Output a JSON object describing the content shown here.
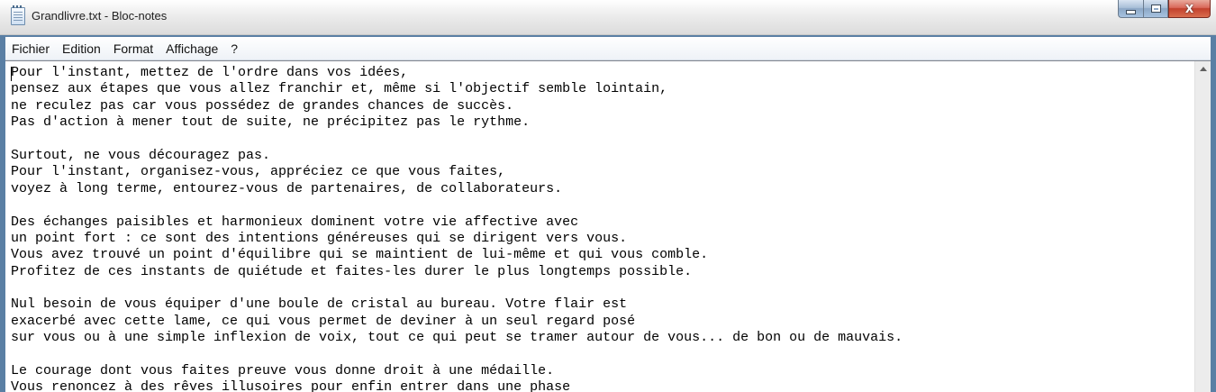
{
  "window": {
    "title": "Grandlivre.txt - Bloc-notes",
    "controls": {
      "minimize_icon": "minimize-icon",
      "maximize_icon": "maximize-icon",
      "close_label": "X"
    }
  },
  "menu": {
    "items": [
      {
        "label": "Fichier"
      },
      {
        "label": "Edition"
      },
      {
        "label": "Format"
      },
      {
        "label": "Affichage"
      },
      {
        "label": "?"
      }
    ]
  },
  "editor": {
    "lines": [
      "Pour l'instant, mettez de l'ordre dans vos idées,",
      "pensez aux étapes que vous allez franchir et, même si l'objectif semble lointain,",
      "ne reculez pas car vous possédez de grandes chances de succès.",
      "Pas d'action à mener tout de suite, ne précipitez pas le rythme.",
      "",
      "Surtout, ne vous découragez pas.",
      "Pour l'instant, organisez-vous, appréciez ce que vous faites,",
      "voyez à long terme, entourez-vous de partenaires, de collaborateurs.",
      "",
      "Des échanges paisibles et harmonieux dominent votre vie affective avec",
      "un point fort : ce sont des intentions généreuses qui se dirigent vers vous.",
      "Vous avez trouvé un point d'équilibre qui se maintient de lui-même et qui vous comble.",
      "Profitez de ces instants de quiétude et faites-les durer le plus longtemps possible.",
      "",
      "Nul besoin de vous équiper d'une boule de cristal au bureau. Votre flair est",
      "exacerbé avec cette lame, ce qui vous permet de deviner à un seul regard posé",
      "sur vous ou à une simple inflexion de voix, tout ce qui peut se tramer autour de vous... de bon ou de mauvais.",
      "",
      "Le courage dont vous faites preuve vous donne droit à une médaille.",
      "Vous renoncez à des rêves illusoires pour enfin entrer dans une phase"
    ],
    "scroll_up_icon": "scroll-up-arrow-icon"
  },
  "colors": {
    "window_frame": "#5a7fa4",
    "close_button": "#c2402d",
    "editor_background": "#ffffff"
  }
}
